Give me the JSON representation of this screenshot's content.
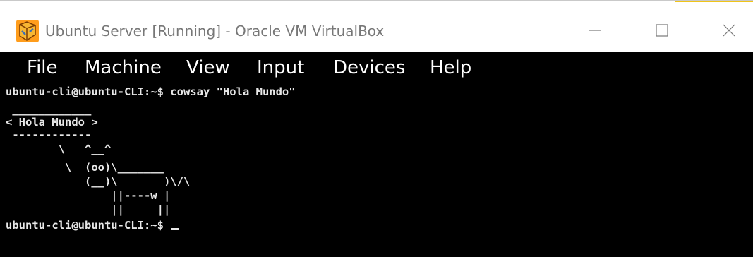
{
  "window": {
    "title": "Ubuntu Server [Running] - Oracle VM VirtualBox",
    "icon": "virtualbox-logo-icon",
    "controls": [
      "minimize-icon",
      "maximize-icon",
      "close-icon"
    ]
  },
  "menubar": {
    "items": [
      "File",
      "Machine",
      "View",
      "Input",
      "Devices",
      "Help"
    ]
  },
  "terminal": {
    "lines": [
      "ubuntu-cli@ubuntu-CLI:~$ cowsay \"Hola Mundo\"",
      " ____________",
      "< Hola Mundo >",
      " ------------",
      "        \\   ^__^",
      "         \\  (oo)\\_______",
      "            (__)\\       )\\/\\",
      "                ||----w |",
      "                ||     ||",
      "ubuntu-cli@ubuntu-CLI:~$ "
    ]
  },
  "colors": {
    "terminal_bg": "#000000",
    "terminal_fg": "#e8e8e8",
    "titlebar_bg": "#ffffff",
    "title_text": "#777777"
  }
}
